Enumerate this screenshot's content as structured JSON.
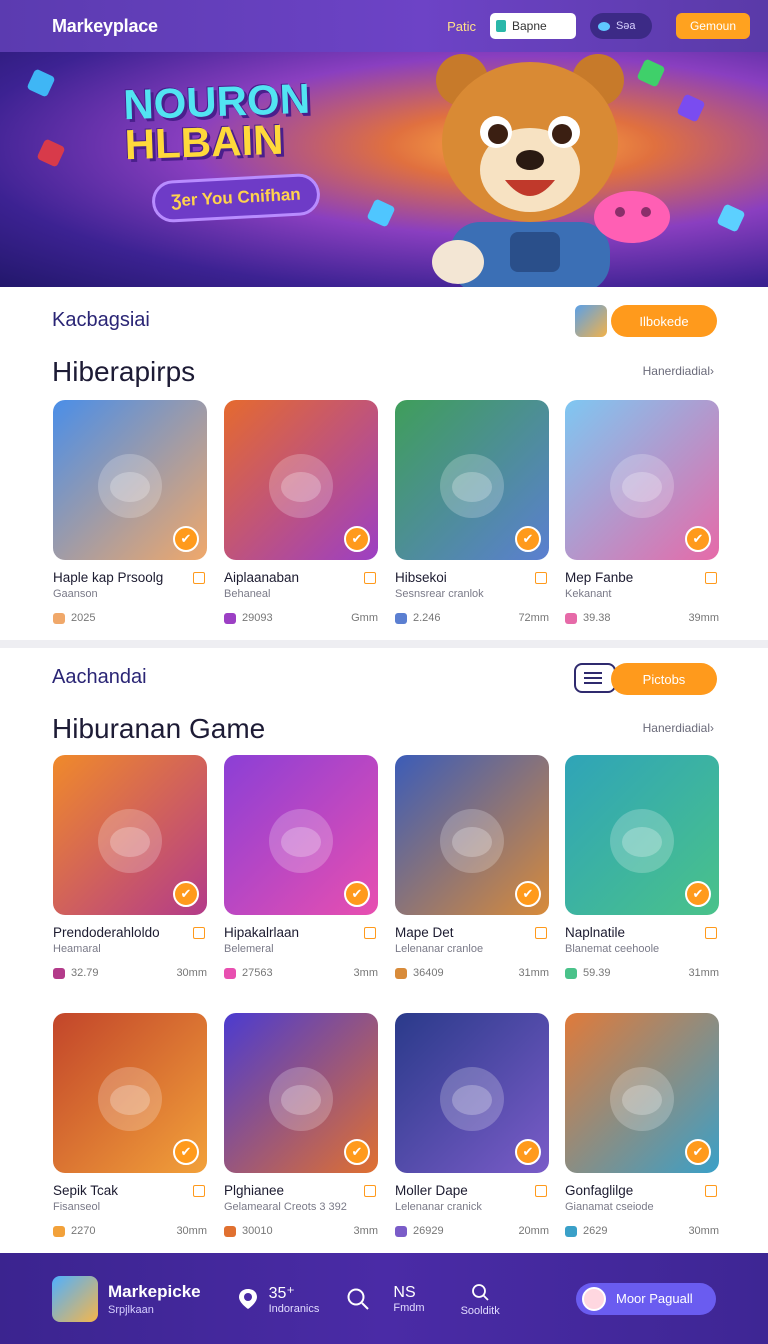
{
  "header": {
    "brand": "Markeyplace",
    "link": "Patic",
    "search_value": "Bapne",
    "wallet": "Səa",
    "button": "Gemoun"
  },
  "hero": {
    "title_line1": "NOURON",
    "title_line2": "HLBAIN",
    "pill": "Ʒer You Cnifhan"
  },
  "section1": {
    "label": "Kacbagsiai",
    "title": "Hiberapirps",
    "see_all": "Hanerdiadial›",
    "button": "Ilbokede",
    "cards": [
      {
        "name": "Haple kap Prsoolg",
        "sub": "Gaanson",
        "stat": "2025",
        "time": "",
        "color1": "#4a8ee8",
        "color2": "#f0a86a"
      },
      {
        "name": "Aiplaanaban",
        "sub": "Behaneal",
        "stat": "29093",
        "time": "Gmm",
        "color1": "#e56a2e",
        "color2": "#9c3fc4"
      },
      {
        "name": "Hibsekoi",
        "sub": "Sesnsrear cranlok",
        "stat": "2.246",
        "time": "72mm",
        "color1": "#3f9e5a",
        "color2": "#5b7fd1"
      },
      {
        "name": "Mep Fanbe",
        "sub": "Kekanant",
        "stat": "39.38",
        "time": "39mm",
        "color1": "#7ec7f2",
        "color2": "#e66aa8"
      }
    ]
  },
  "section2": {
    "label": "Aachandai",
    "title": "Hiburanan Game",
    "see_all": "Hanerdiadial›",
    "button": "Pictobs",
    "cards": [
      {
        "name": "Prendoderahloldo",
        "sub": "Heamaral",
        "stat": "32.79",
        "time": "30mm",
        "color1": "#f08a2a",
        "color2": "#b33b8a"
      },
      {
        "name": "Hipakalrlaan",
        "sub": "Belemeral",
        "stat": "27563",
        "time": "3mm",
        "color1": "#8b3fd6",
        "color2": "#e84fb0"
      },
      {
        "name": "Mape Det",
        "sub": "Lelenanar cranloe",
        "stat": "36409",
        "time": "31mm",
        "color1": "#3b5cb8",
        "color2": "#d88b3a"
      },
      {
        "name": "Naplnatile",
        "sub": "Blanemat ceehoole",
        "stat": "59.39",
        "time": "31mm",
        "color1": "#2fa4b8",
        "color2": "#4ac28a"
      },
      {
        "name": "Sepik Tcak",
        "sub": "Fisanseol",
        "stat": "2270",
        "time": "30mm",
        "color1": "#c2452a",
        "color2": "#f2a13a"
      },
      {
        "name": "Plghianee",
        "sub": "Gelamearal Creots 3 392",
        "stat": "30010",
        "time": "3mm",
        "color1": "#4b3bd0",
        "color2": "#e07030"
      },
      {
        "name": "Moller Dape",
        "sub": "Lelenanar cranick",
        "stat": "26929",
        "time": "20mm",
        "color1": "#2a3a8a",
        "color2": "#7a5cc8"
      },
      {
        "name": "Gonfaglilge",
        "sub": "Gianamat cseiode",
        "stat": "2629",
        "time": "30mm",
        "color1": "#e07a3a",
        "color2": "#3aa0c8"
      }
    ]
  },
  "bottom_nav": {
    "brand": "Markepicke",
    "brand_sub": "Srpjlkaan",
    "item1_top": "35⁺",
    "item1_bottom": "Indoranics",
    "item2_top": "NS",
    "item2_bottom": "Fmdm",
    "item3_bottom": "Soolditk",
    "cta": "Moor Paguall"
  },
  "icons": [
    "pin-icon",
    "search-icon",
    "list-icon",
    "check-badge-icon",
    "heart-icon"
  ],
  "colors": {
    "accent": "#ff9a1c",
    "brand_purple": "#5b3bb0",
    "text_dark": "#1d1b35"
  }
}
